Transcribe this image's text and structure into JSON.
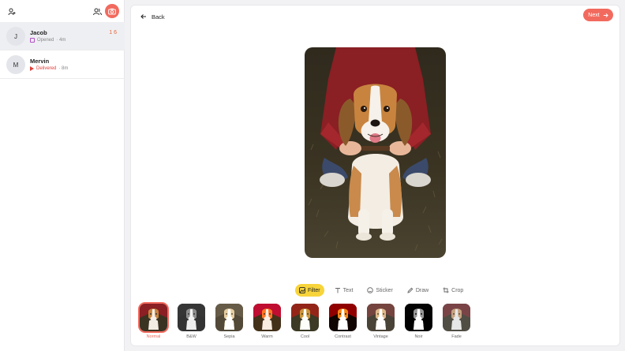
{
  "sidebar": {
    "header_icons": [
      "add-contact-icon",
      "group-icon",
      "camera-icon"
    ],
    "chats": [
      {
        "initial": "J",
        "name": "Jacob",
        "status": "Opened",
        "time": "· 4m",
        "count": "1 6",
        "status_icon": "opened-square-icon"
      },
      {
        "initial": "M",
        "name": "Mervin",
        "status": "Delivered",
        "time": "· 8m",
        "status_icon": "delivered-arrow-icon"
      }
    ]
  },
  "editor": {
    "back_label": "Back",
    "next_label": "Next",
    "tools": [
      {
        "label": "Filter",
        "icon": "filter-icon",
        "active": true
      },
      {
        "label": "Text",
        "icon": "text-icon"
      },
      {
        "label": "Sticker",
        "icon": "sticker-icon"
      },
      {
        "label": "Draw",
        "icon": "pencil-icon"
      },
      {
        "label": "Crop",
        "icon": "crop-icon"
      }
    ],
    "filters": [
      {
        "label": "Normal",
        "selected": true
      },
      {
        "label": "B&W"
      },
      {
        "label": "Sepia"
      },
      {
        "label": "Warm"
      },
      {
        "label": "Cool"
      },
      {
        "label": "Contrast"
      },
      {
        "label": "Vintage"
      },
      {
        "label": "Noir"
      },
      {
        "label": "Fade"
      }
    ]
  },
  "colors": {
    "accent": "#f26a5e",
    "tool_active": "#f7d43a",
    "opened": "#b14fc5",
    "delivered": "#e0403a"
  }
}
